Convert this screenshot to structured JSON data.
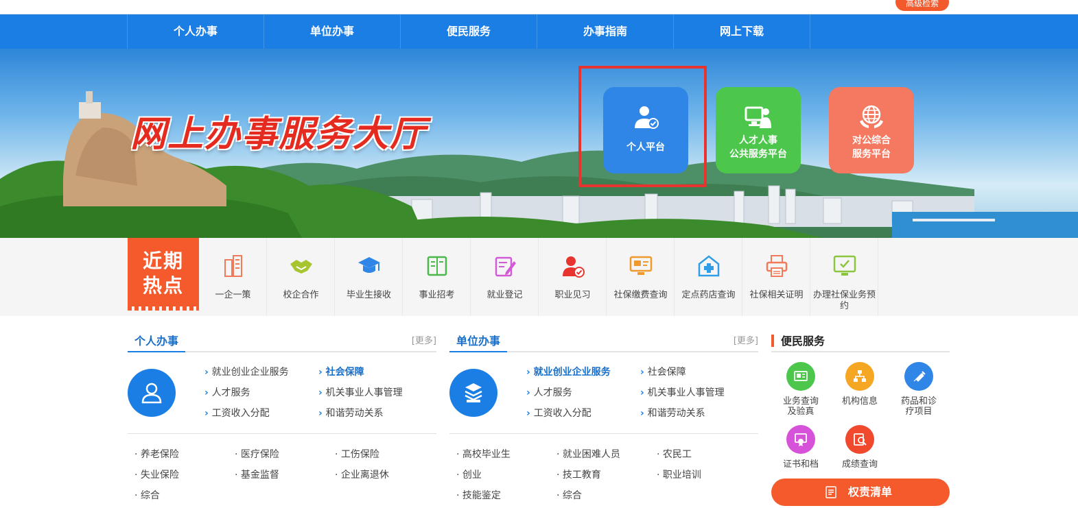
{
  "top": {
    "advanced_search": "高级检索"
  },
  "nav": {
    "items": [
      "个人办事",
      "单位办事",
      "便民服务",
      "办事指南",
      "网上下载"
    ]
  },
  "banner": {
    "title": "网上办事服务大厅",
    "tiles": [
      {
        "label_lines": [
          "个人平台"
        ],
        "color": "#2f86e6",
        "icon": "personal-user-icon"
      },
      {
        "label_lines": [
          "人才人事",
          "公共服务平台"
        ],
        "color": "#4cc64b",
        "icon": "talent-computer-icon"
      },
      {
        "label_lines": [
          "对公综合",
          "服务平台"
        ],
        "color": "#f57860",
        "icon": "globe-hands-icon"
      }
    ],
    "highlight_color": "#e8342f"
  },
  "hot": {
    "badge_lines": [
      "近期",
      "热点"
    ],
    "items": [
      {
        "label": "一企一策",
        "icon": "building-icon",
        "color": "#f07a5a"
      },
      {
        "label": "校企合作",
        "icon": "handshake-icon",
        "color": "#a6c52f"
      },
      {
        "label": "毕业生接收",
        "icon": "graduation-cap-icon",
        "color": "#2f86e6"
      },
      {
        "label": "事业招考",
        "icon": "book-icon",
        "color": "#4cb84c"
      },
      {
        "label": "就业登记",
        "icon": "edit-form-icon",
        "color": "#d35ad6"
      },
      {
        "label": "职业见习",
        "icon": "user-check-icon",
        "color": "#e8342f"
      },
      {
        "label": "社保缴费查询",
        "icon": "monitor-card-icon",
        "color": "#f09a2e"
      },
      {
        "label": "定点药店查询",
        "icon": "pharmacy-icon",
        "color": "#2f9ee6"
      },
      {
        "label": "社保相关证明",
        "icon": "printer-icon",
        "color": "#f07a5a"
      },
      {
        "label": "办理社保业务预约",
        "icon": "monitor-check-icon",
        "color": "#8cc63f"
      }
    ]
  },
  "personal": {
    "title": "个人办事",
    "more": "[更多]",
    "links": [
      {
        "label": "就业创业企业服务",
        "hl": false
      },
      {
        "label": "社会保障",
        "hl": true
      },
      {
        "label": "人才服务",
        "hl": false
      },
      {
        "label": "机关事业人事管理",
        "hl": false
      },
      {
        "label": "工资收入分配",
        "hl": false
      },
      {
        "label": "和谐劳动关系",
        "hl": false
      }
    ],
    "sub": [
      "养老保险",
      "医疗保险",
      "工伤保险",
      "失业保险",
      "基金监督",
      "企业离退休",
      "综合"
    ]
  },
  "unit": {
    "title": "单位办事",
    "more": "[更多]",
    "links": [
      {
        "label": "就业创业企业服务",
        "hl": true
      },
      {
        "label": "社会保障",
        "hl": false
      },
      {
        "label": "人才服务",
        "hl": false
      },
      {
        "label": "机关事业人事管理",
        "hl": false
      },
      {
        "label": "工资收入分配",
        "hl": false
      },
      {
        "label": "和谐劳动关系",
        "hl": false
      }
    ],
    "sub": [
      "高校毕业生",
      "就业困难人员",
      "农民工",
      "创业",
      "技工教育",
      "职业培训",
      "技能鉴定",
      "综合"
    ]
  },
  "convenience": {
    "title": "便民服务",
    "items": [
      {
        "label_lines": [
          "业务查询",
          "及验真"
        ],
        "color": "#4cc64b",
        "icon": "query-verify-icon"
      },
      {
        "label_lines": [
          "机构信息"
        ],
        "color": "#f5a623",
        "icon": "org-chart-icon"
      },
      {
        "label_lines": [
          "药品和诊",
          "疗项目"
        ],
        "color": "#2f86e6",
        "icon": "syringe-icon"
      },
      {
        "label_lines": [
          "证书和档"
        ],
        "color": "#d653d9",
        "icon": "certificate-icon"
      },
      {
        "label_lines": [
          "成绩查询"
        ],
        "color": "#f0492e",
        "icon": "score-search-icon"
      }
    ],
    "button_label": "权责清单"
  }
}
